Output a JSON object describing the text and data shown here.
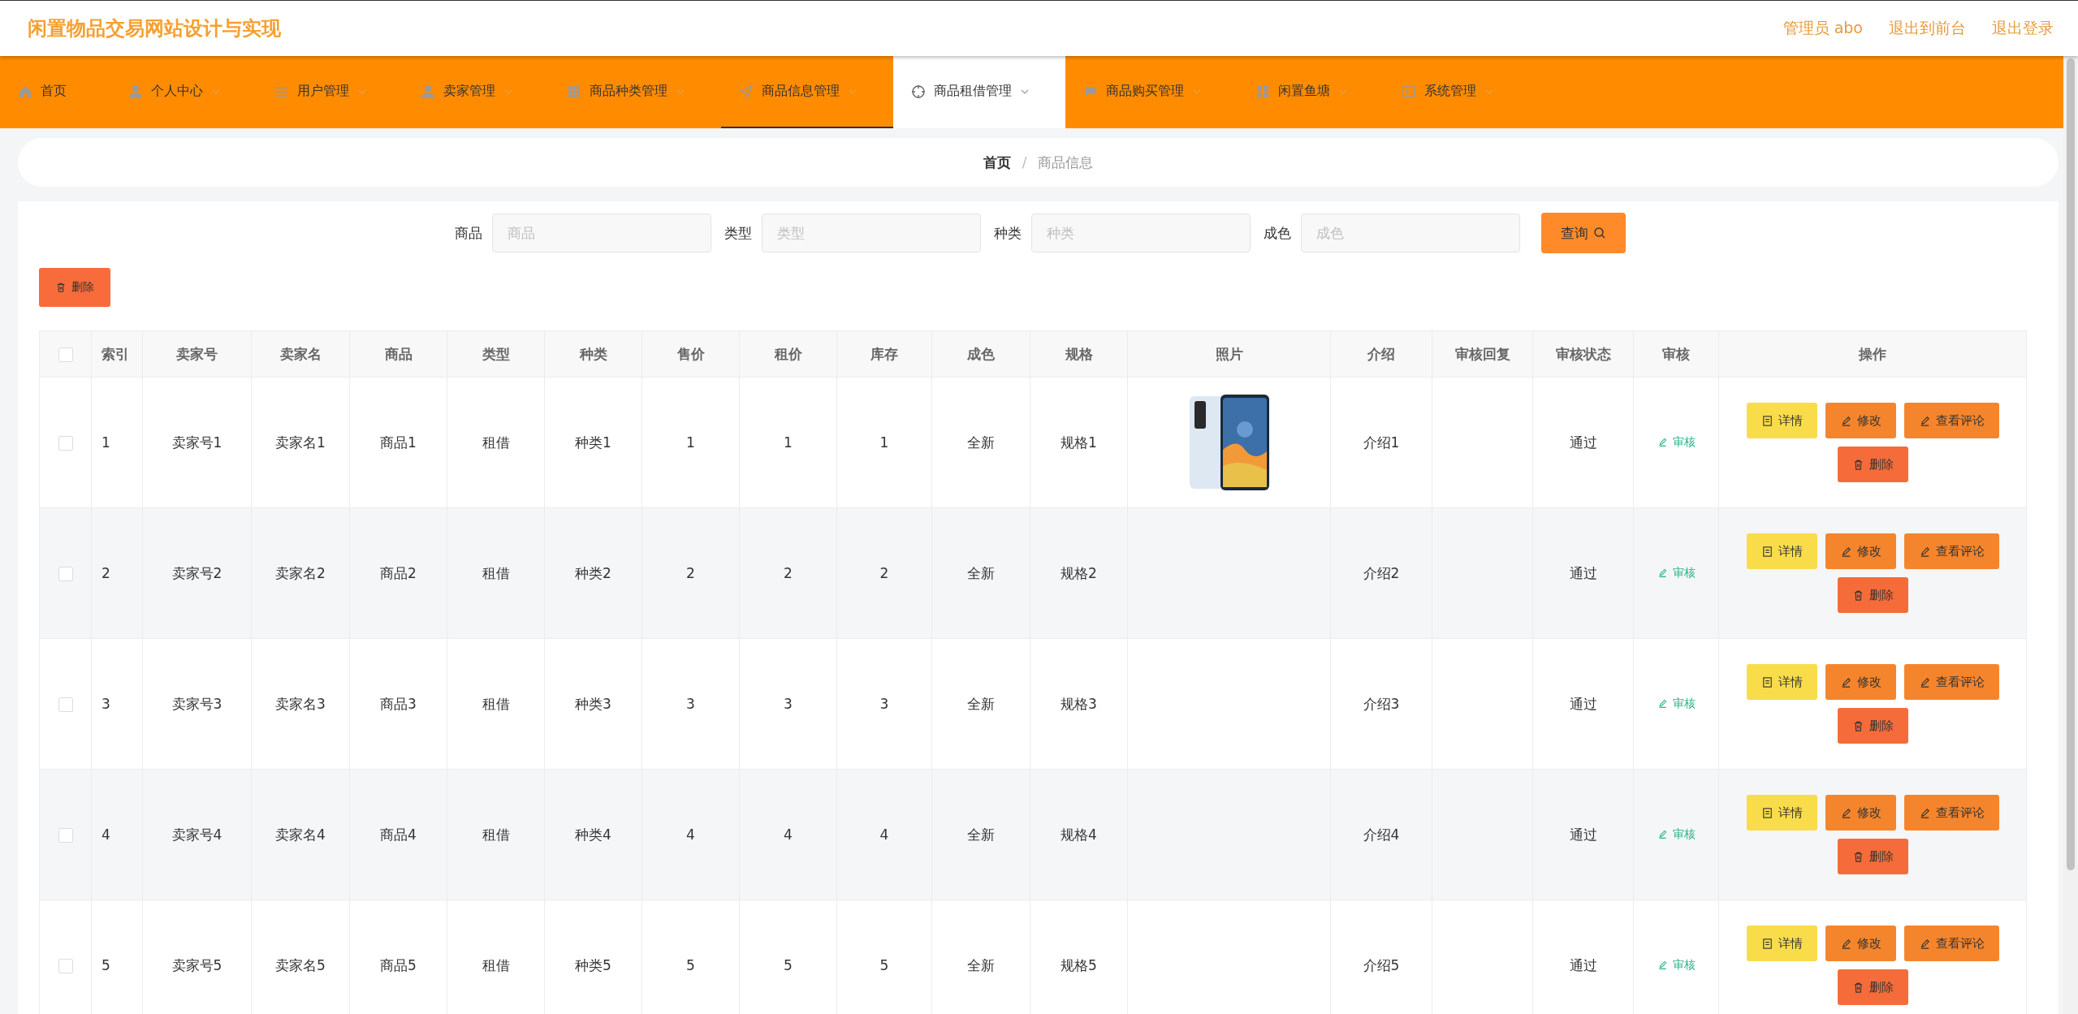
{
  "header": {
    "title": "闲置物品交易网站设计与实现",
    "links": [
      "管理员 abo",
      "退出到前台",
      "退出登录"
    ]
  },
  "nav": [
    {
      "label": "首页",
      "dropdown": false,
      "selected": false,
      "hovered": false
    },
    {
      "label": "个人中心",
      "dropdown": true,
      "selected": false,
      "hovered": false
    },
    {
      "label": "用户管理",
      "dropdown": true,
      "selected": false,
      "hovered": false
    },
    {
      "label": "卖家管理",
      "dropdown": true,
      "selected": false,
      "hovered": false
    },
    {
      "label": "商品种类管理",
      "dropdown": true,
      "selected": false,
      "hovered": false
    },
    {
      "label": "商品信息管理",
      "dropdown": true,
      "selected": true,
      "hovered": false
    },
    {
      "label": "商品租借管理",
      "dropdown": true,
      "selected": false,
      "hovered": true
    },
    {
      "label": "商品购买管理",
      "dropdown": true,
      "selected": false,
      "hovered": false
    },
    {
      "label": "闲置鱼塘",
      "dropdown": true,
      "selected": false,
      "hovered": false
    },
    {
      "label": "系统管理",
      "dropdown": true,
      "selected": false,
      "hovered": false
    }
  ],
  "breadcrumb": {
    "items": [
      "首页",
      "商品信息"
    ],
    "separator": "/"
  },
  "search": {
    "fields": [
      {
        "label": "商品",
        "placeholder": "商品"
      },
      {
        "label": "类型",
        "placeholder": "类型"
      },
      {
        "label": "种类",
        "placeholder": "种类"
      },
      {
        "label": "成色",
        "placeholder": "成色"
      }
    ],
    "button": "查询"
  },
  "bulk_delete": "删除",
  "table": {
    "all_checked": false,
    "columns": [
      "索引",
      "卖家号",
      "卖家名",
      "商品",
      "类型",
      "种类",
      "售价",
      "租价",
      "库存",
      "成色",
      "规格",
      "照片",
      "介绍",
      "审核回复",
      "审核状态",
      "审核",
      "操作"
    ],
    "rows": [
      {
        "checked": false,
        "cells": [
          "1",
          "卖家号1",
          "卖家名1",
          "商品1",
          "租借",
          "种类1",
          "1",
          "1",
          "1",
          "全新",
          "规格1"
        ],
        "photo": {
          "kind": "picture"
        },
        "intro": "介绍1",
        "reply": "",
        "status": "通过",
        "review": "审核",
        "actions": [
          "详情",
          "修改",
          "查看评论",
          "删除"
        ]
      },
      {
        "checked": false,
        "cells": [
          "2",
          "卖家号2",
          "卖家名2",
          "商品2",
          "租借",
          "种类2",
          "2",
          "2",
          "2",
          "全新",
          "规格2"
        ],
        "intro": "介绍2",
        "status": "通过",
        "review": "审核",
        "actions": [
          "详情",
          "修改",
          "查看评论",
          "删除"
        ]
      },
      {
        "checked": false,
        "cells": [
          "3",
          "卖家号3",
          "卖家名3",
          "商品3",
          "租借",
          "种类3",
          "3",
          "3",
          "3",
          "全新",
          "规格3"
        ],
        "intro": "介绍3",
        "status": "通过",
        "review": "审核",
        "actions": [
          "详情",
          "修改",
          "查看评论",
          "删除"
        ]
      },
      {
        "checked": false,
        "cells": [
          "4",
          "卖家号4",
          "卖家名4",
          "商品4",
          "租借",
          "种类4",
          "4",
          "4",
          "4",
          "全新",
          "规格4"
        ],
        "intro": "介绍4",
        "status": "通过",
        "review": "审核",
        "actions": [
          "详情",
          "修改",
          "查看评论",
          "删除"
        ]
      },
      {
        "checked": false,
        "cells": [
          "5",
          "卖家号5",
          "卖家名5",
          "商品5",
          "租借",
          "种类5",
          "5",
          "5",
          "5",
          "全新",
          "规格5"
        ],
        "intro": "介绍5",
        "status": "通过",
        "review": "审核",
        "actions": [
          "详情",
          "修改",
          "查看评论",
          "删除"
        ]
      }
    ]
  }
}
